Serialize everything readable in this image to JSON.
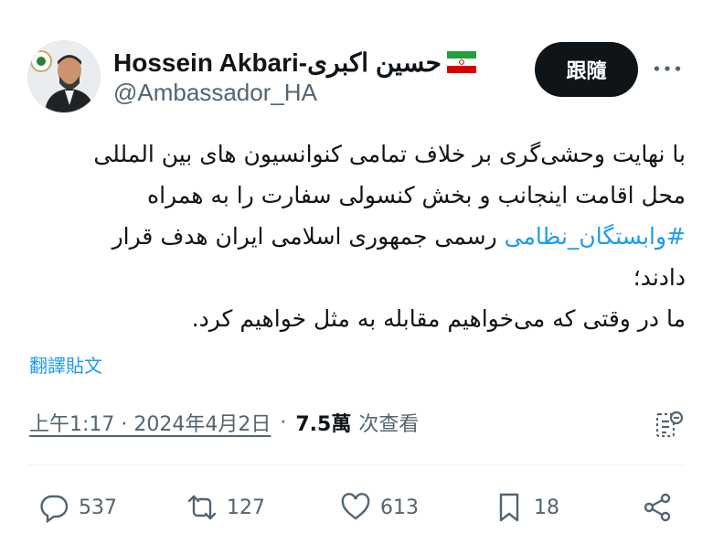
{
  "author": {
    "display_name": "Hossein Akbari-حسین اکبری",
    "handle": "@Ambassador_HA",
    "flag_icon": "iran-flag-icon"
  },
  "follow_button": {
    "label": "跟隨"
  },
  "more_icon": "ellipsis-icon",
  "tweet": {
    "lines": [
      "با نهایت وحشی‌گری بر خلاف تمامی کنوانسیون های بین المللی",
      "محل اقامت اینجانب و بخش کنسولی سفارت را به همراه",
      "رسمی جمهوری اسلامی ایران هدف قرار",
      "دادند؛",
      "ما در وقتی که می‌خواهیم مقابله به مثل خواهیم کرد."
    ],
    "hashtag": "#وابستگان_نظامی"
  },
  "translate_link": "翻譯貼文",
  "meta": {
    "time": "上午1:17 · 2024年4月2日",
    "separator": "·",
    "views_count": "7.5萬",
    "views_label": "次查看"
  },
  "actions": {
    "replies": "537",
    "reposts": "127",
    "likes": "613",
    "bookmarks": "18"
  },
  "colors": {
    "text": "#0f1419",
    "secondary": "#536471",
    "link": "#1d9bf0",
    "button_bg": "#0f1419"
  }
}
